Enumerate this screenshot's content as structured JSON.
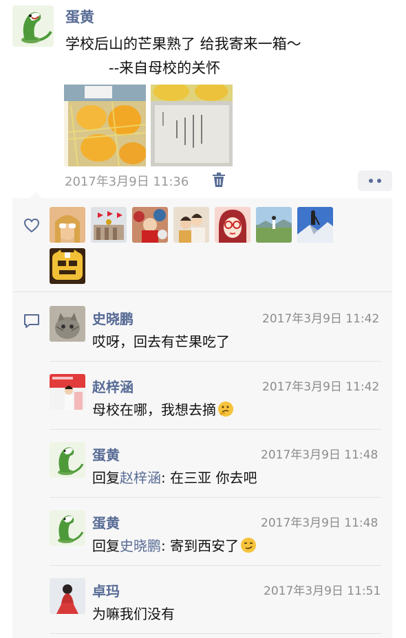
{
  "post": {
    "author": "蛋黄",
    "text_line1": "学校后山的芒果熟了  给我寄来一箱～",
    "text_line2": "--来自母校的关怀",
    "photos": [
      "mango-box-photo",
      "handwritten-note-photo"
    ],
    "timestamp": "2017年3月9日 11:36"
  },
  "likes": {
    "icon": "heart-icon",
    "avatars": [
      "sunglasses-woman",
      "government-building",
      "festival-crowd",
      "two-friends",
      "red-sunglasses-girl",
      "field-walker",
      "mountain-hiker",
      "yellow-cat-cartoon"
    ]
  },
  "comments": [
    {
      "name": "史晓鹏",
      "time": "2017年3月9日 11:42",
      "text": "哎呀，回去有芒果吃了"
    },
    {
      "name": "赵梓涵",
      "time": "2017年3月9日 11:42",
      "text": "母校在哪，我想去摘",
      "emoji": "thinking-face"
    },
    {
      "name": "蛋黄",
      "time": "2017年3月9日 11:48",
      "reply_prefix": "回复",
      "reply_to": "赵梓涵",
      "reply_text": ": 在三亚 你去吧"
    },
    {
      "name": "蛋黄",
      "time": "2017年3月9日 11:48",
      "reply_prefix": "回复",
      "reply_to": "史晓鹏",
      "reply_text": ": 寄到西安了",
      "emoji": "smirk-face"
    },
    {
      "name": "卓玛",
      "time": "2017年3月9日 11:51",
      "text": "为嘛我们没有"
    }
  ],
  "colors": {
    "name_link": "#576b95",
    "panel_bg": "#f7f7f7",
    "meta_gray": "#9a9a9a"
  }
}
